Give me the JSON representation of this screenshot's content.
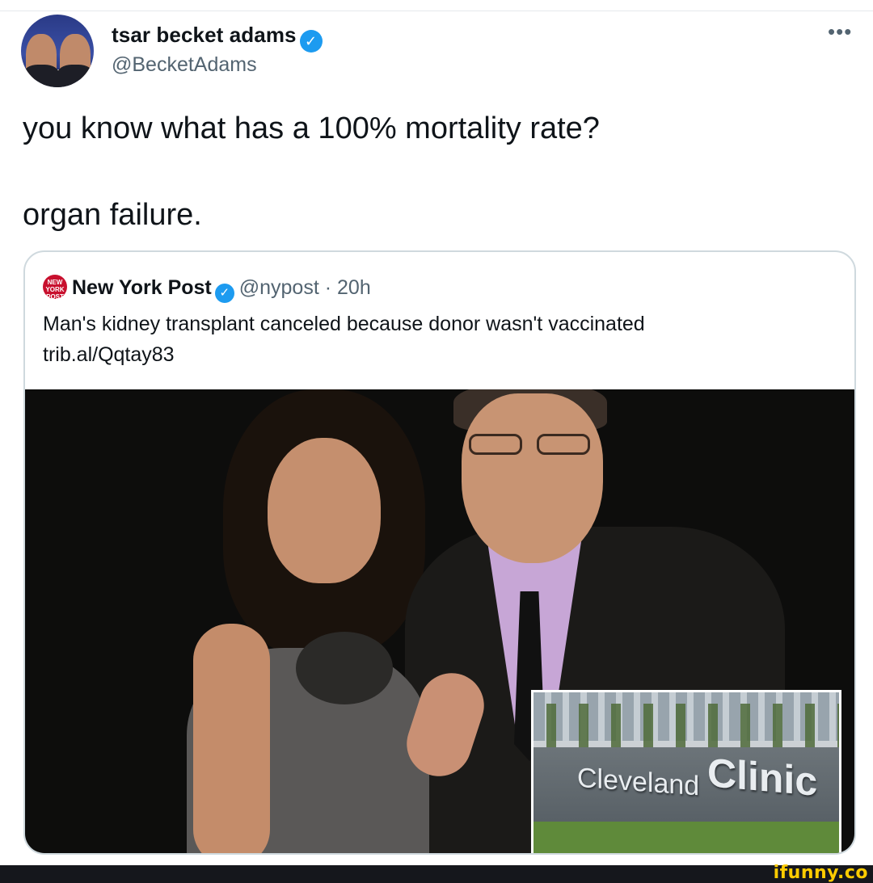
{
  "tweet": {
    "author_name": "tsar becket adams",
    "author_handle": "@BecketAdams",
    "more_icon": "more-horizontal-icon",
    "verified_icon": "check",
    "text_line_1": "you know what has a 100% mortality rate?",
    "text_line_2": "organ failure."
  },
  "quote": {
    "logo_text": "NEW YORK POST",
    "author_name": "New York Post",
    "author_handle": "@nypost",
    "separator": "·",
    "time": "20h",
    "headline": "Man's kidney transplant canceled because donor wasn't vaccinated",
    "link": "trib.al/Qqtay83",
    "inset_sign_1": "Cleveland",
    "inset_sign_2": "Clinic"
  },
  "watermark": "ifunny.co",
  "colors": {
    "verified_blue": "#1d9bf0",
    "secondary_text": "#536471",
    "border": "#cfd9de",
    "nypost_red": "#c8102e",
    "watermark_yellow": "#ffcc00"
  }
}
